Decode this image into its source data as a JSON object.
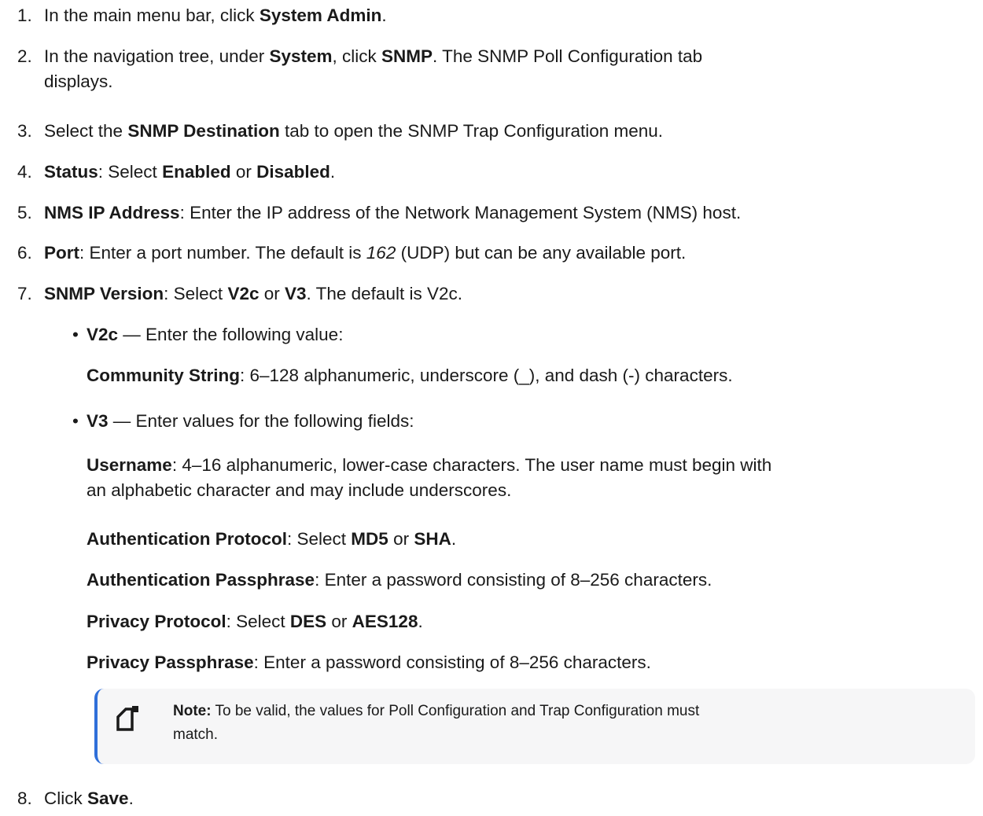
{
  "steps": [
    {
      "num": "1.",
      "parts": [
        "In the main menu bar, click ",
        "System Admin",
        "."
      ]
    },
    {
      "num": "2.",
      "parts": [
        "In the navigation tree, under ",
        "System",
        ", click ",
        "SNMP",
        ". The SNMP Poll Configuration tab",
        "displays."
      ]
    },
    {
      "num": "3.",
      "parts": [
        "Select the ",
        "SNMP Destination",
        " tab to open the SNMP Trap Configuration menu."
      ]
    },
    {
      "num": "4.",
      "parts": [
        "Status",
        ": Select ",
        "Enabled",
        " or ",
        "Disabled",
        "."
      ]
    },
    {
      "num": "5.",
      "parts": [
        "NMS IP Address",
        ": Enter the IP address of the Network Management System (NMS) host."
      ]
    },
    {
      "num": "6.",
      "parts": [
        "Port",
        ": Enter a port number. The default is ",
        "162",
        " (UDP) but can be any available port."
      ]
    },
    {
      "num": "7.",
      "parts": [
        "SNMP Version",
        ": Select ",
        "V2c",
        " or ",
        "V3",
        ". The default is V2c."
      ]
    },
    {
      "num": "8.",
      "parts": [
        "Click ",
        "Save",
        "."
      ]
    }
  ],
  "bullets": [
    {
      "glyph": "•",
      "parts": [
        "V2c",
        " — Enter the following value:"
      ]
    },
    {
      "glyph": "•",
      "parts": [
        "V3",
        " — Enter values for the following fields:"
      ]
    }
  ],
  "fields": {
    "community": [
      "Community String",
      ": 6–128 alphanumeric, underscore (_), and dash (-) characters."
    ],
    "username": [
      "Username",
      ": 4–16 alphanumeric, lower-case characters. The user name must begin with",
      "an alphabetic character and may include underscores."
    ],
    "auth_protocol": [
      "Authentication Protocol",
      ": Select ",
      "MD5",
      " or ",
      "SHA",
      "."
    ],
    "auth_pass": [
      "Authentication Passphrase",
      ": Enter a password consisting of 8–256 characters."
    ],
    "priv_protocol": [
      "Privacy Protocol",
      ": Select ",
      "DES",
      " or ",
      "AES128",
      "."
    ],
    "priv_pass": [
      "Privacy Passphrase",
      ": Enter a password consisting of 8–256 characters."
    ]
  },
  "note": {
    "label": "Note:",
    "line1": " To be valid, the values for Poll Configuration and Trap Configuration must",
    "line2": "match.",
    "icon": "note-icon",
    "accent": "#2f6fd9"
  }
}
